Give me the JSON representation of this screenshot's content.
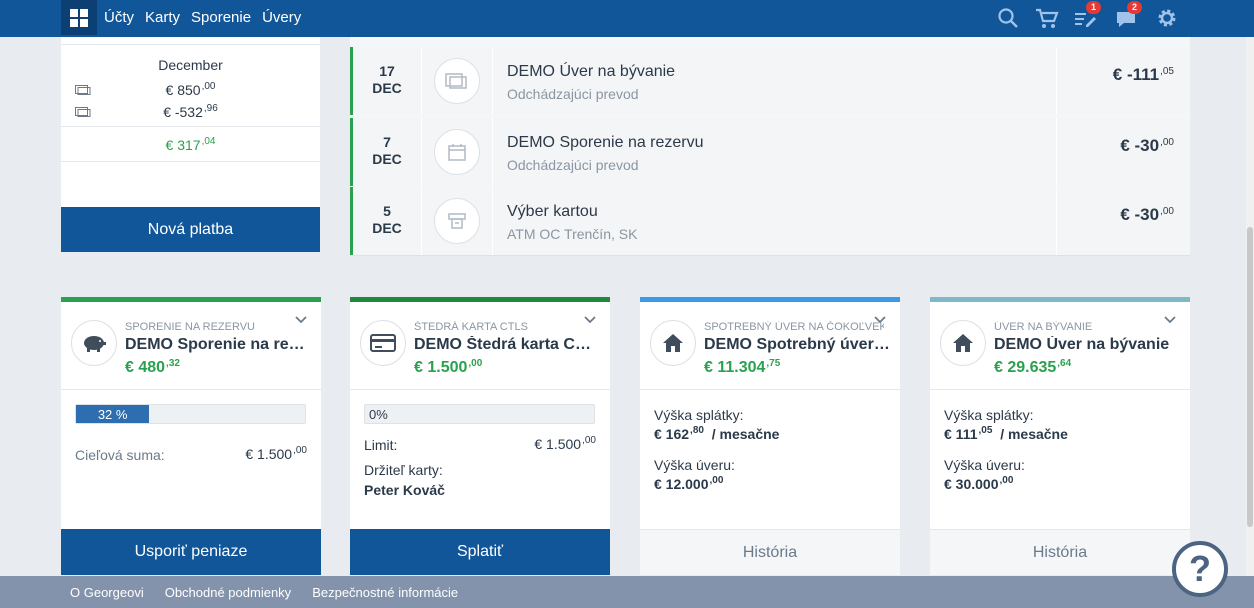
{
  "nav": {
    "items": [
      "Účty",
      "Karty",
      "Sporenie",
      "Úvery"
    ],
    "cart_badge": "",
    "tasks_badge": "1",
    "messages_badge": "2"
  },
  "left_panel": {
    "month": "December",
    "rows": [
      {
        "amount": "€ 850",
        "decimals": ",00"
      },
      {
        "amount": "€ -532",
        "decimals": ",96"
      }
    ],
    "total": {
      "amount": "€ 317",
      "decimals": ",04"
    },
    "button_label": "Nová platba"
  },
  "transactions": [
    {
      "day": "17",
      "month": "DEC",
      "name": "DEMO Úver na bývanie",
      "sub": "Odchádzajúci prevod",
      "amount": "€ -111",
      "decimals": ",05",
      "icon": "transfer-icon"
    },
    {
      "day": "7",
      "month": "DEC",
      "name": "DEMO Sporenie na rezervu",
      "sub": "Odchádzajúci prevod",
      "amount": "€ -30",
      "decimals": ",00",
      "icon": "calendar-icon"
    },
    {
      "day": "5",
      "month": "DEC",
      "name": "Výber kartou",
      "sub": "ATM OC Trenčín, SK",
      "amount": "€ -30",
      "decimals": ",00",
      "icon": "atm-icon"
    }
  ],
  "cards": [
    {
      "type": "SPORENIE NA REZERVU",
      "name": "DEMO Sporenie na rezervu",
      "balance": "€ 480",
      "balance_dec": ",32",
      "accent": "#2aa14e",
      "icon": "piggy-bank-icon",
      "progress": 0.32,
      "progress_label": "32 %",
      "target_label": "Cieľová suma:",
      "target_value": "€ 1.500",
      "target_dec": ",00",
      "button_label": "Usporiť peniaze"
    },
    {
      "type": "ŠTEDRÁ KARTA CTLS",
      "name": "DEMO Štedrá karta CTLS",
      "balance": "€ 1.500",
      "balance_dec": ",00",
      "accent": "#1f8a3c",
      "icon": "credit-card-icon",
      "progress": 0,
      "progress_label": "0%",
      "limit_label": "Limit:",
      "limit_value": "€ 1.500",
      "limit_dec": ",00",
      "holder_label": "Držiteľ karty:",
      "holder_value": "Peter Kováč",
      "button_label": "Splatiť"
    },
    {
      "type": "SPOTREBNÝ ÚVER NA ČOKOĽVEK",
      "name": "DEMO Spotrebný úver na čokoľvek",
      "balance": "€ 11.304",
      "balance_dec": ",75",
      "accent": "#3a9ae8",
      "icon": "house-icon",
      "installment_label": "Výška splátky:",
      "installment_value": "€ 162",
      "installment_dec": ",80",
      "installment_period": "/ mesačne",
      "loan_label": "Výška úveru:",
      "loan_value": "€ 12.000",
      "loan_dec": ",00",
      "button_label": "História"
    },
    {
      "type": "ÚVER NA BÝVANIE",
      "name": "DEMO Úver na bývanie",
      "balance": "€ 29.635",
      "balance_dec": ",64",
      "accent": "#7fb8c9",
      "icon": "house-icon",
      "installment_label": "Výška splátky:",
      "installment_value": "€ 111",
      "installment_dec": ",05",
      "installment_period": "/ mesačne",
      "loan_label": "Výška úveru:",
      "loan_value": "€ 30.000",
      "loan_dec": ",00",
      "button_label": "História"
    }
  ],
  "footer": {
    "links": [
      "O Georgeovi",
      "Obchodné podmienky",
      "Bezpečnostné informácie"
    ]
  },
  "help_label": "?"
}
